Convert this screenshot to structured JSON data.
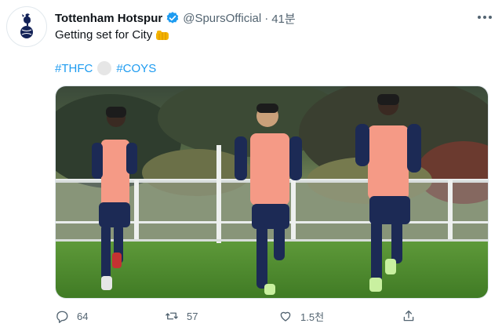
{
  "account": {
    "display_name": "Tottenham Hotspur",
    "handle": "@SpursOfficial",
    "separator": "·",
    "time": "41분",
    "avatar_icon": "spurs-cockerel-crest-icon",
    "verified_icon": "verified-badge-icon",
    "verified_color": "#1d9bf0"
  },
  "tweet": {
    "text": "Getting set for City",
    "emoji": "oncoming-fist-emoji",
    "hashtags": [
      "#THFC",
      "#COYS"
    ],
    "hashtag_separator_emoji": "white-circle-emoji",
    "link_color": "#1d9bf0"
  },
  "actions": {
    "reply_count": "64",
    "retweet_count": "57",
    "like_count": "1.5천",
    "reply_icon": "reply-bubble-icon",
    "retweet_icon": "retweet-icon",
    "like_icon": "heart-icon",
    "share_icon": "share-upload-icon",
    "more_icon": "more-dots-icon"
  },
  "photo": {
    "subject": "three-players-running-training"
  }
}
